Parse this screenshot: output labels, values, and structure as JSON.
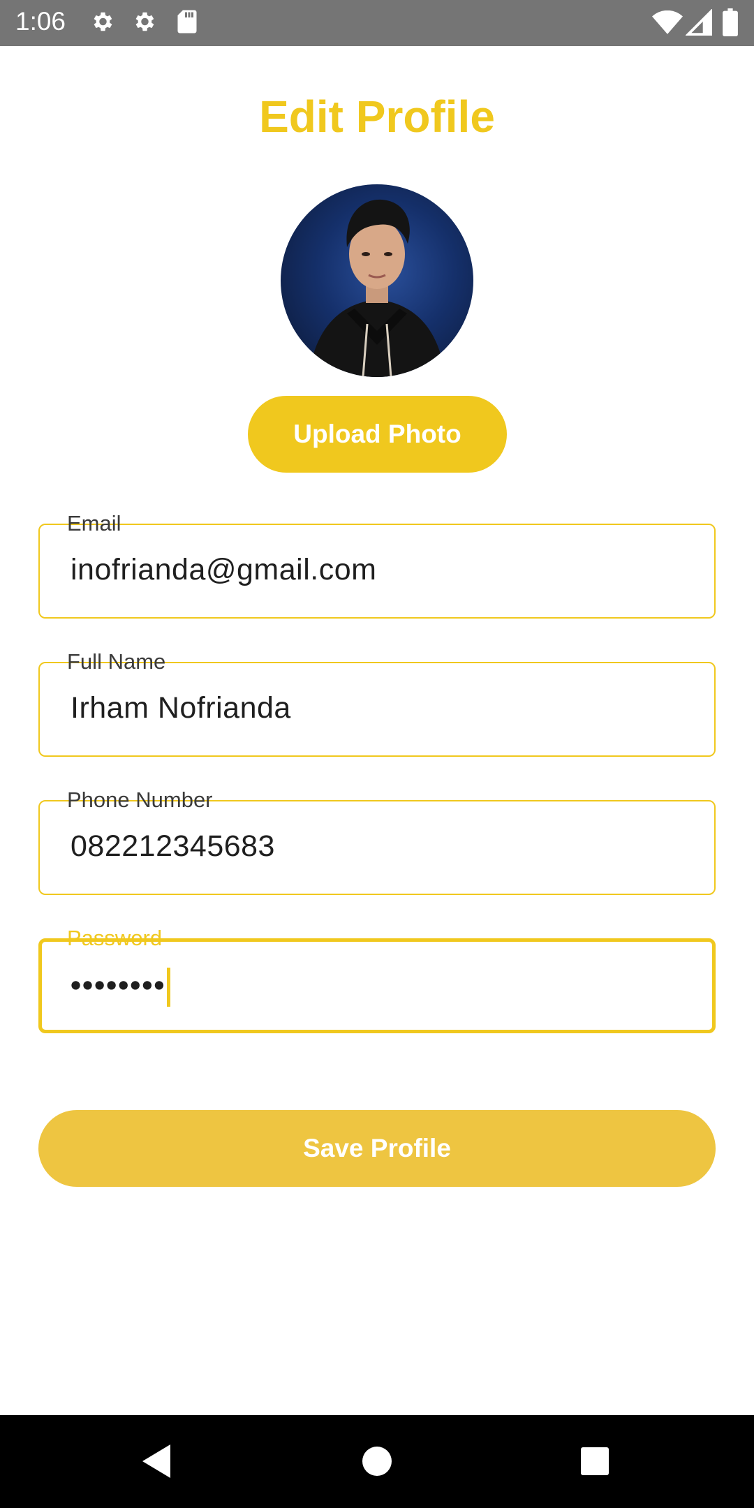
{
  "status_bar": {
    "time": "1:06",
    "left_icons": [
      "settings-gear-icon",
      "settings-gear-icon",
      "sd-card-icon"
    ],
    "right_icons": [
      "wifi-icon",
      "signal-icon",
      "battery-icon"
    ]
  },
  "page": {
    "title": "Edit Profile",
    "upload_label": "Upload Photo",
    "save_label": "Save Profile"
  },
  "form": {
    "email": {
      "label": "Email",
      "value": "inofrianda@gmail.com"
    },
    "full_name": {
      "label": "Full Name",
      "value": "Irham Nofrianda"
    },
    "phone": {
      "label": "Phone Number",
      "value": "082212345683"
    },
    "password": {
      "label": "Password",
      "value": "••••••••"
    }
  },
  "nav": {
    "icons": [
      "back-icon",
      "home-icon",
      "recents-icon"
    ]
  },
  "colors": {
    "accent": "#f0c81e",
    "save_button": "#eec541",
    "status_bar": "#757575",
    "nav_bar": "#000000"
  }
}
